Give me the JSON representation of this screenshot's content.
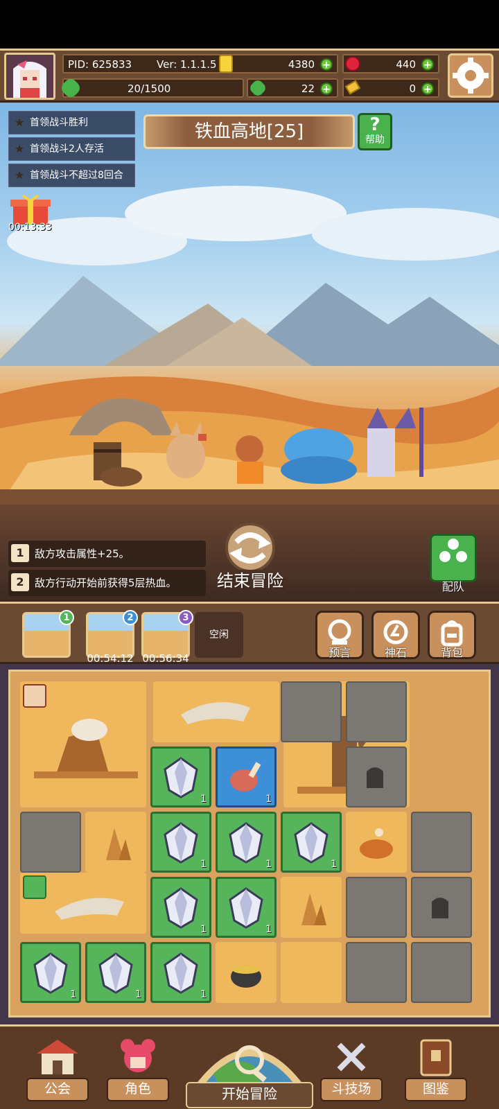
{
  "player": {
    "pid": "PID: 625833",
    "version": "Ver: 1.1.1.5",
    "stamina": "20/1500"
  },
  "currency": {
    "gold": "4380",
    "ruby": "440",
    "clover": "22",
    "key": "0"
  },
  "quests": [
    "首领战斗胜利",
    "首领战斗2人存活",
    "首领战斗不超过8回合"
  ],
  "stage": {
    "name": "铁血高地[25]",
    "help_label": "帮助"
  },
  "gift_timer": "00:13:33",
  "effects": [
    {
      "num": "1",
      "text": "敌方攻击属性+25。"
    },
    {
      "num": "2",
      "text": "敌方行动开始前获得5层热血。"
    }
  ],
  "end_adventure_label": "结束冒险",
  "formation_label": "配队",
  "queue": {
    "slots": [
      {
        "badge": "1",
        "timer": ""
      },
      {
        "badge": "2",
        "timer": "00:54:12"
      },
      {
        "badge": "3",
        "timer": "00:56:34"
      }
    ],
    "idle_label": "空闲",
    "buttons": [
      "预言",
      "神石",
      "背包"
    ]
  },
  "grid_counts": {
    "r2c3": "1",
    "r2c4": "1",
    "r3c3": "1",
    "r3c4": "1",
    "r3c5": "1",
    "r4c3": "1",
    "r4c4": "1",
    "r5c1": "1",
    "r5c2": "1",
    "r5c3": "1"
  },
  "nav": [
    "公会",
    "角色",
    "开始冒险",
    "斗技场",
    "图鉴"
  ],
  "colors": {
    "sand": "#f0b85c",
    "gem_cell": "#56b55a",
    "meat_cell": "#3d8fd8",
    "stone": "#7b7773"
  }
}
